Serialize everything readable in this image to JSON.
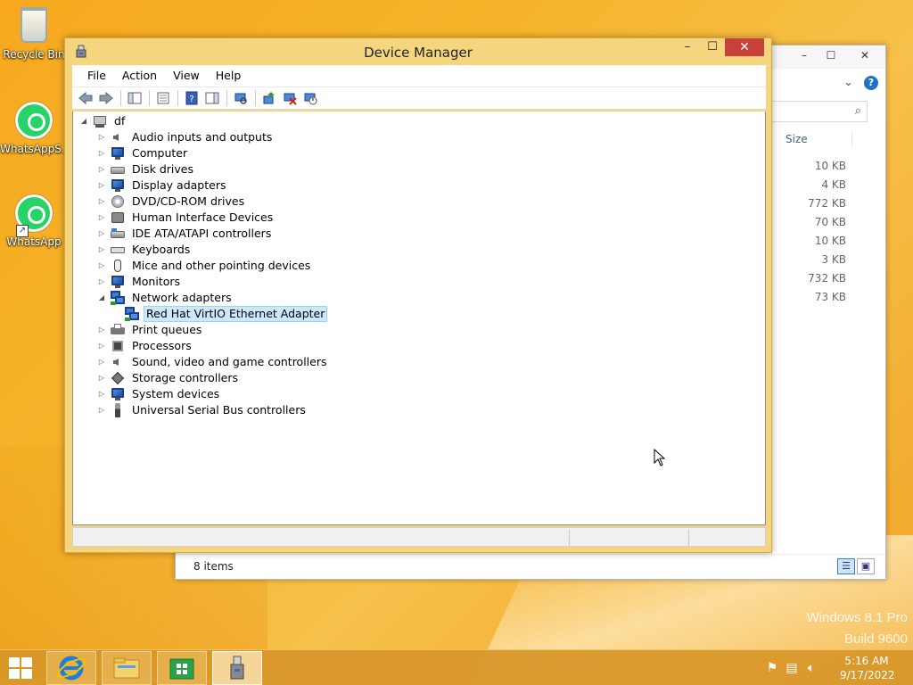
{
  "desktop": {
    "icons": [
      {
        "label": "Recycle Bin"
      },
      {
        "label": "WhatsAppS..."
      },
      {
        "label": "WhatsApp"
      }
    ],
    "watermark_line1": "Windows 8.1 Pro",
    "watermark_line2": "Build 9600"
  },
  "explorer": {
    "column_size": "Size",
    "sizes": [
      "10 KB",
      "4 KB",
      "772 KB",
      "70 KB",
      "10 KB",
      "3 KB",
      "732 KB",
      "73 KB"
    ],
    "status_items": "8 items",
    "minimize": "–",
    "maximize": "☐",
    "close": "✕"
  },
  "device_manager": {
    "title": "Device Manager",
    "minimize": "–",
    "maximize": "☐",
    "close": "✕",
    "menu": [
      "File",
      "Action",
      "View",
      "Help"
    ],
    "tree": {
      "root": "df",
      "items": [
        {
          "label": "Audio inputs and outputs",
          "icon": "speaker-icon",
          "expanded": false
        },
        {
          "label": "Computer",
          "icon": "computer-icon",
          "expanded": false
        },
        {
          "label": "Disk drives",
          "icon": "disk-drive-icon",
          "expanded": false
        },
        {
          "label": "Display adapters",
          "icon": "display-adapter-icon",
          "expanded": false
        },
        {
          "label": "DVD/CD-ROM drives",
          "icon": "cd-drive-icon",
          "expanded": false
        },
        {
          "label": "Human Interface Devices",
          "icon": "hid-icon",
          "expanded": false
        },
        {
          "label": "IDE ATA/ATAPI controllers",
          "icon": "ide-controller-icon",
          "expanded": false
        },
        {
          "label": "Keyboards",
          "icon": "keyboard-icon",
          "expanded": false
        },
        {
          "label": "Mice and other pointing devices",
          "icon": "mouse-icon",
          "expanded": false
        },
        {
          "label": "Monitors",
          "icon": "monitor-icon",
          "expanded": false
        },
        {
          "label": "Network adapters",
          "icon": "network-adapter-icon",
          "expanded": true
        },
        {
          "label": "Red Hat VirtIO Ethernet Adapter",
          "icon": "network-adapter-icon",
          "child": true,
          "selected": true
        },
        {
          "label": "Print queues",
          "icon": "printer-icon",
          "expanded": false
        },
        {
          "label": "Processors",
          "icon": "processor-icon",
          "expanded": false
        },
        {
          "label": "Sound, video and game controllers",
          "icon": "speaker-icon",
          "expanded": false
        },
        {
          "label": "Storage controllers",
          "icon": "storage-controller-icon",
          "expanded": false
        },
        {
          "label": "System devices",
          "icon": "system-devices-icon",
          "expanded": false
        },
        {
          "label": "Universal Serial Bus controllers",
          "icon": "usb-icon",
          "expanded": false
        }
      ]
    }
  },
  "taskbar": {
    "time": "5:16 AM",
    "date": "9/17/2022"
  },
  "colors": {
    "desktop_orange": "#f5b52c",
    "window_frame": "#f5d67e",
    "close_red": "#c7403a",
    "selection": "#cce8ff"
  }
}
